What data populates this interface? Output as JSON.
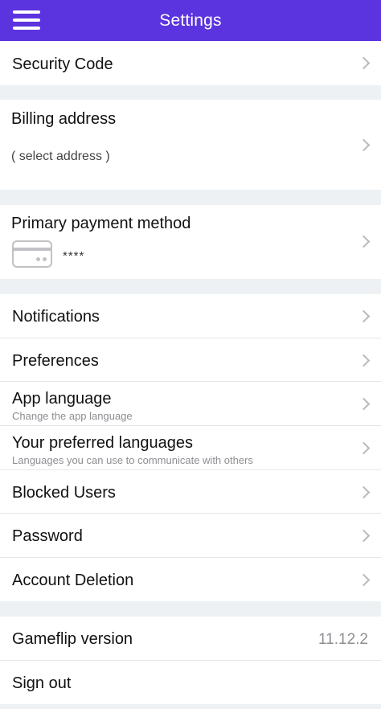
{
  "header": {
    "title": "Settings"
  },
  "security": {
    "label": "Security Code"
  },
  "billing": {
    "label": "Billing address",
    "value": "( select address )"
  },
  "payment": {
    "label": "Primary payment method",
    "masked": "****"
  },
  "list": {
    "notifications": "Notifications",
    "preferences": "Preferences",
    "app_language": {
      "label": "App language",
      "sub": "Change the app language"
    },
    "preferred_languages": {
      "label": "Your preferred languages",
      "sub": "Languages you can use to communicate with others"
    },
    "blocked_users": "Blocked Users",
    "password": "Password",
    "account_deletion": "Account Deletion"
  },
  "footer": {
    "version_label": "Gameflip version",
    "version_value": "11.12.2",
    "sign_out": "Sign out"
  },
  "colors": {
    "header_bg": "#5b34e0",
    "section_bg": "#eef1f3"
  }
}
